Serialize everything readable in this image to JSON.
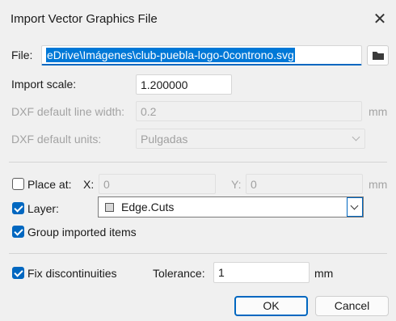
{
  "dialog": {
    "title": "Import Vector Graphics File"
  },
  "file": {
    "label": "File:",
    "value": "eDrive\\Imágenes\\club-puebla-logo-0controno.svg"
  },
  "import_scale": {
    "label": "Import scale:",
    "value": "1.200000"
  },
  "dxf_line_width": {
    "label": "DXF default line width:",
    "value": "0.2",
    "unit": "mm"
  },
  "dxf_units": {
    "label": "DXF default units:",
    "value": "Pulgadas"
  },
  "place_at": {
    "label": "Place at:",
    "checked": false,
    "x_label": "X:",
    "x_value": "0",
    "y_label": "Y:",
    "y_value": "0",
    "unit": "mm"
  },
  "layer": {
    "label": "Layer:",
    "checked": true,
    "value": "Edge.Cuts",
    "swatch_color": "#d9d9d9"
  },
  "group": {
    "label": "Group imported items",
    "checked": true
  },
  "fix": {
    "label": "Fix discontinuities",
    "checked": true,
    "tolerance_label": "Tolerance:",
    "tolerance_value": "1",
    "unit": "mm"
  },
  "buttons": {
    "ok": "OK",
    "cancel": "Cancel"
  },
  "colors": {
    "accent": "#0067c0",
    "selection": "#0078d7"
  }
}
